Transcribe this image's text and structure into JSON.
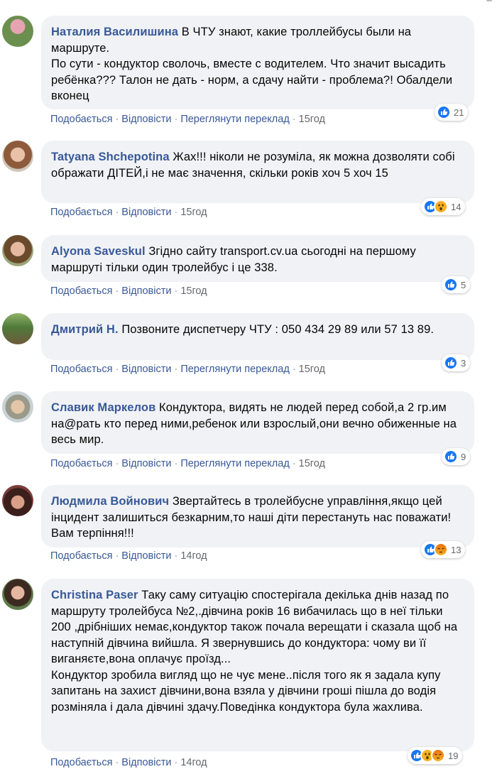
{
  "actions": {
    "like": "Подобається",
    "reply": "Відповісти",
    "translate": "Переглянути переклад",
    "sep": "·"
  },
  "comments": [
    {
      "author": "Наталия Василишина",
      "text": "В ЧТУ знают, какие троллейбусы были на маршруте.\nПо сути - кондуктор сволочь, вместе с водителем. Что значит высадить ребёнка??? Талон не дать - норм, а сдачу найти - проблема?! Обалдели вконец",
      "time": "15год",
      "reactions": [
        "like"
      ],
      "count": "21"
    },
    {
      "author": "Tatyana Shchepotina",
      "text": "Жах!!! ніколи не розуміла, як можна дозволяти собі ображати ДІТЕЙ,і не має значення, скільки років хоч 5 хоч 15",
      "time": "15год",
      "reactions": [
        "like",
        "wow"
      ],
      "count": "14"
    },
    {
      "author": "Alyona Saveskul",
      "text": "Згідно сайту transport.cv.ua сьогодні на першому маршруті тільки один тролейбус і це 338.",
      "time": "15год",
      "reactions": [
        "like"
      ],
      "count": "5"
    },
    {
      "author": "Дмитрий Н.",
      "text": "Позвоните диспетчеру ЧТУ : 050 434 29 89 или 57 13 89.",
      "time": "15год",
      "reactions": [
        "like"
      ],
      "count": "3"
    },
    {
      "author": "Славик Маркелов",
      "text": "Кондуктора, видять не людей перед собой,а 2 гр.им на@рать кто перед ними,ребенок или взрослый,они вечно обиженные на весь мир.",
      "time": "15год",
      "reactions": [
        "like"
      ],
      "count": "9"
    },
    {
      "author": "Людмила Войнович",
      "text": "Звертайтесь в тролейбусне управління,якщо цей інцидент залишиться безкарним,то наші діти перестануть нас поважати! Вам терпіння!!!",
      "time": "14год",
      "reactions": [
        "like",
        "angry"
      ],
      "count": "13"
    },
    {
      "author": "Christina Paser",
      "text": "Таку саму ситуацію спостерігала декілька днів назад по маршруту тролейбуса №2,.дівчина років 16 вибачилась що в неї тільки 200 ,дрібніших немає,кондуктор також почала верещати і сказала щоб на наступній дівчина вийшла. Я звернувшись до кондуктора: чому ви її виганяєте,вона оплачує проїзд...\nКондуктор зробила вигляд що не чує мене..після того як я задала купу запитань на захист дівчини,вона взяла у дівчини гроші пішла до водія розміняла і дала дівчині здачу.Поведінка кондуктора була жахлива.",
      "time": "14год",
      "reactions": [
        "like",
        "wow",
        "angry"
      ],
      "count": "19"
    }
  ]
}
